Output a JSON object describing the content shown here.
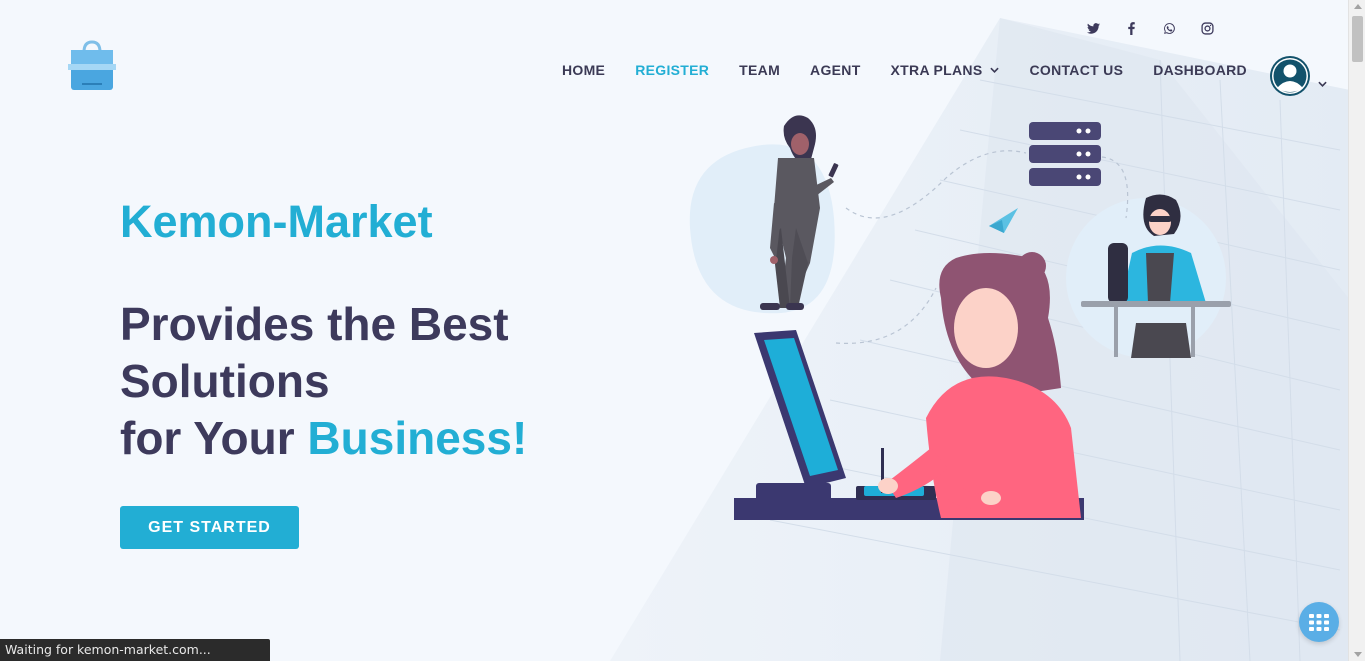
{
  "header": {
    "logo_icon": "shopping-bag-logo",
    "social": [
      {
        "name": "twitter-icon"
      },
      {
        "name": "facebook-icon"
      },
      {
        "name": "whatsapp-icon"
      },
      {
        "name": "instagram-icon"
      }
    ],
    "nav": [
      {
        "label": "HOME",
        "active": false
      },
      {
        "label": "REGISTER",
        "active": true
      },
      {
        "label": "TEAM",
        "active": false
      },
      {
        "label": "AGENT",
        "active": false
      },
      {
        "label": "XTRA PLANS",
        "active": false,
        "dropdown": true
      },
      {
        "label": "CONTACT US",
        "active": false
      },
      {
        "label": "DASHBOARD",
        "active": false
      }
    ],
    "avatar_icon": "user-avatar-icon"
  },
  "hero": {
    "brand": "Kemon-Market",
    "title_line1": "Provides the Best",
    "title_line2": "Solutions",
    "title_line3_prefix": "for Your ",
    "title_line3_accent": "Business!",
    "cta_label": "GET STARTED"
  },
  "status_bar": {
    "text": "Waiting for kemon-market.com..."
  },
  "colors": {
    "accent": "#22aed4",
    "heading": "#3d3a5c",
    "background": "#f4f8fd"
  }
}
